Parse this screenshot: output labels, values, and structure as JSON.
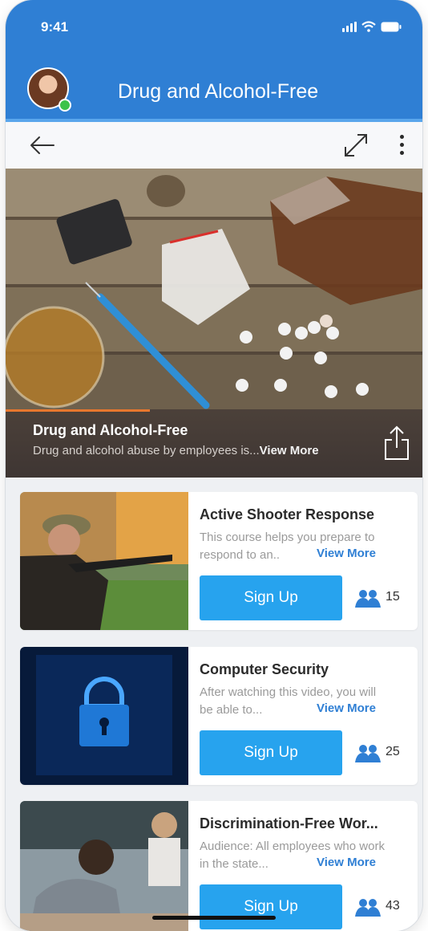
{
  "status_bar": {
    "time": "9:41"
  },
  "header": {
    "title": "Drug and Alcohol-Free"
  },
  "hero": {
    "title": "Drug and Alcohol-Free",
    "description": "Drug and alcohol abuse by employees is...",
    "more_label": "View More"
  },
  "courses": [
    {
      "title": "Active Shooter Response",
      "description": "This course helps you prepare to respond to an..",
      "more_label": "View More",
      "button_label": "Sign Up",
      "attendees": "15"
    },
    {
      "title": "Computer Security",
      "description": "After watching this video, you will be able to...",
      "more_label": "View More",
      "button_label": "Sign Up",
      "attendees": "25"
    },
    {
      "title": "Discrimination-Free Wor...",
      "description": "Audience: All employees who work in the state...",
      "more_label": "View More",
      "button_label": "Sign Up",
      "attendees": "43"
    }
  ],
  "colors": {
    "header": "#2f7fd4",
    "button": "#27a3ee",
    "link": "#2f7fd4",
    "progress": "#e8772e"
  },
  "icons": [
    "signal-icon",
    "wifi-icon",
    "battery-icon",
    "back-arrow-icon",
    "expand-icon",
    "more-vertical-icon",
    "share-icon",
    "attendees-icon"
  ]
}
